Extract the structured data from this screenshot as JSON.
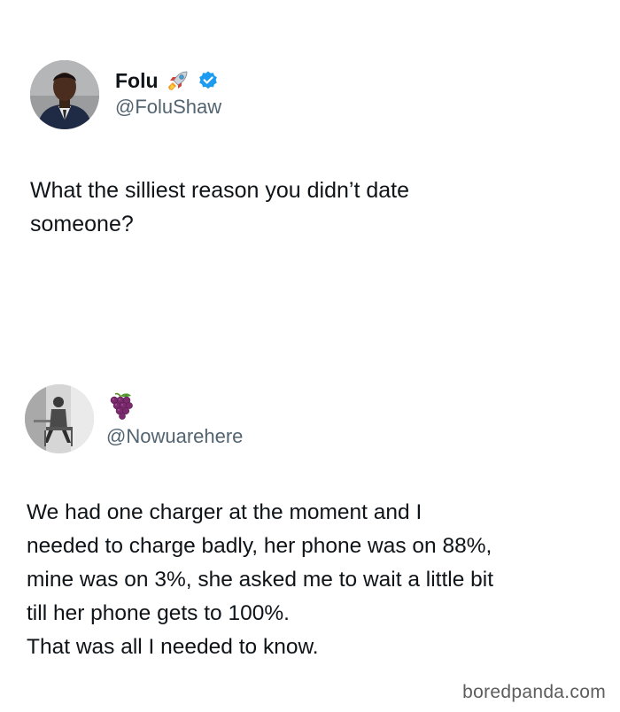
{
  "tweet_main": {
    "display_name": "Folu",
    "name_emoji": "rocket-icon",
    "verified": "verified-badge-icon",
    "handle": "@FoluShaw",
    "text": "What the silliest reason you didn’t date\nsomeone?"
  },
  "reply": {
    "name_emoji": "grapes-icon",
    "handle": "@Nowuarehere",
    "text": "We had one charger at the moment and I\nneeded to charge badly, her phone was on 88%,\nmine was on 3%, she asked me to wait a little bit\ntill her phone gets to 100%.\nThat was all I needed to know."
  },
  "watermark": {
    "text": "boredpanda.com"
  },
  "colors": {
    "verified_blue": "#1d9bf0",
    "text_primary": "#0f1419",
    "text_secondary": "#536471"
  }
}
